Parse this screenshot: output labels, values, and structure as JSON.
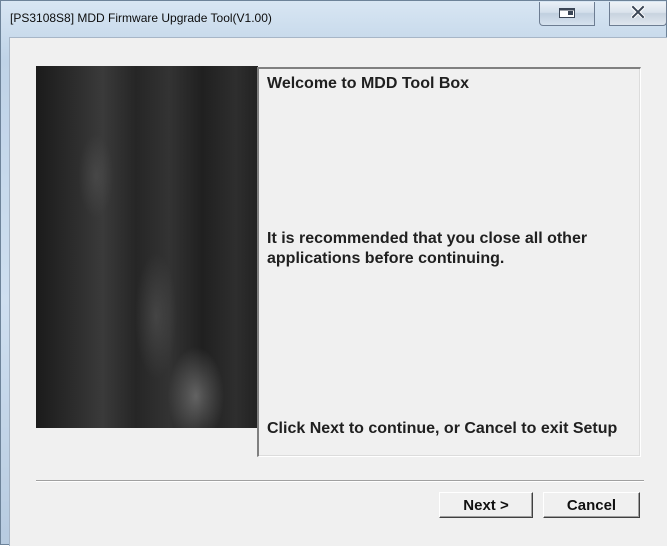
{
  "window": {
    "title": "[PS3108S8] MDD Firmware Upgrade Tool(V1.00)",
    "controls": {
      "restore_icon": "restore-icon",
      "close_icon": "close-icon"
    }
  },
  "panel": {
    "welcome": "Welcome to MDD Tool Box",
    "recommendation": "It is recommended that you close all other applications before continuing.",
    "instruction": "Click Next to continue, or Cancel to exit Setup"
  },
  "buttons": {
    "next_label": "Next >",
    "cancel_label": "Cancel"
  },
  "colors": {
    "title_bar": "#bfd3e7",
    "client_bg": "#f0f0f0"
  }
}
